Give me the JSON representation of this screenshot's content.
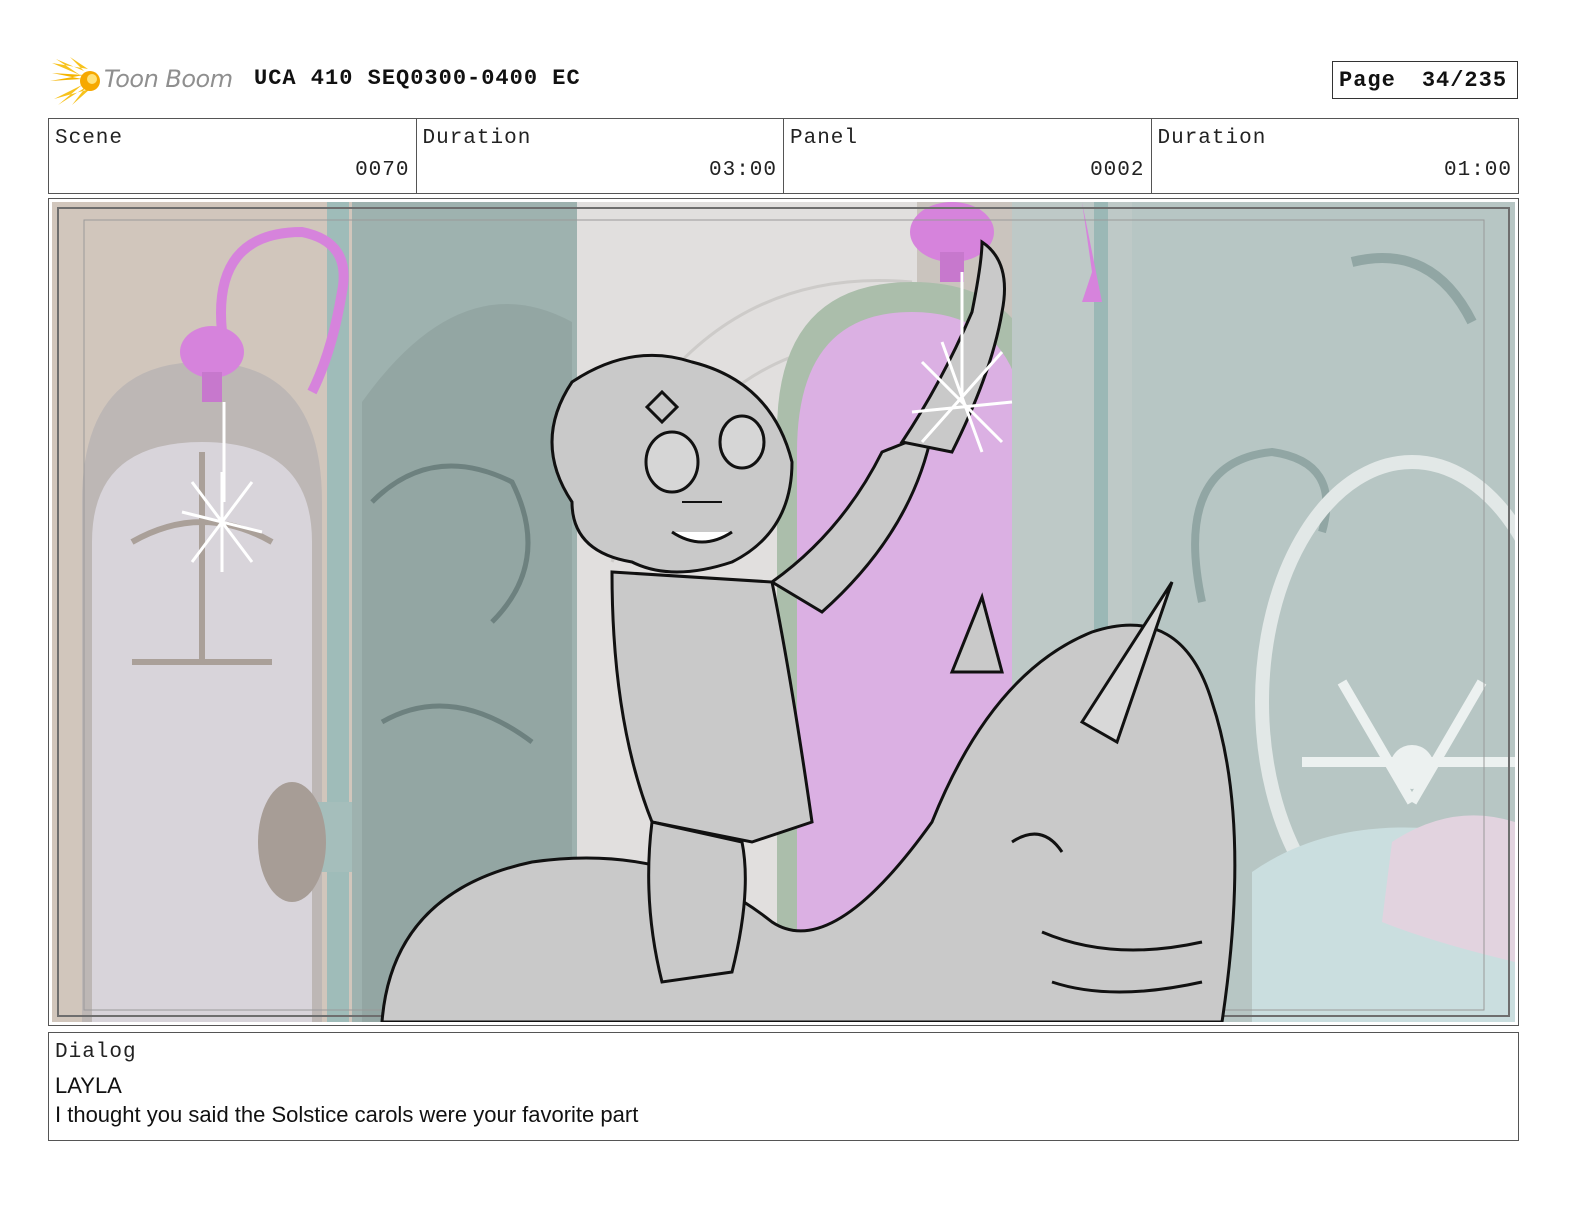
{
  "header": {
    "logo_text": "Toon Boom",
    "title": "UCA 410 SEQ0300-0400 EC",
    "page_label": "Page",
    "page_number": "34/235"
  },
  "info": {
    "scene_label": "Scene",
    "scene_value": "0070",
    "scene_duration_label": "Duration",
    "scene_duration_value": "03:00",
    "panel_label": "Panel",
    "panel_value": "0002",
    "panel_duration_label": "Duration",
    "panel_duration_value": "01:00"
  },
  "dialog": {
    "label": "Dialog",
    "speaker": "LAYLA",
    "line": "I thought you said the Solstice carols were your favorite part"
  },
  "colors": {
    "logo_yellow": "#f7c21c",
    "wall_teal": "#9fb3b0",
    "wall_tan": "#b39a86",
    "door_magenta": "#cf96da",
    "lamp_magenta": "#c85ad0",
    "sketch_gray": "#c9c9c9"
  }
}
